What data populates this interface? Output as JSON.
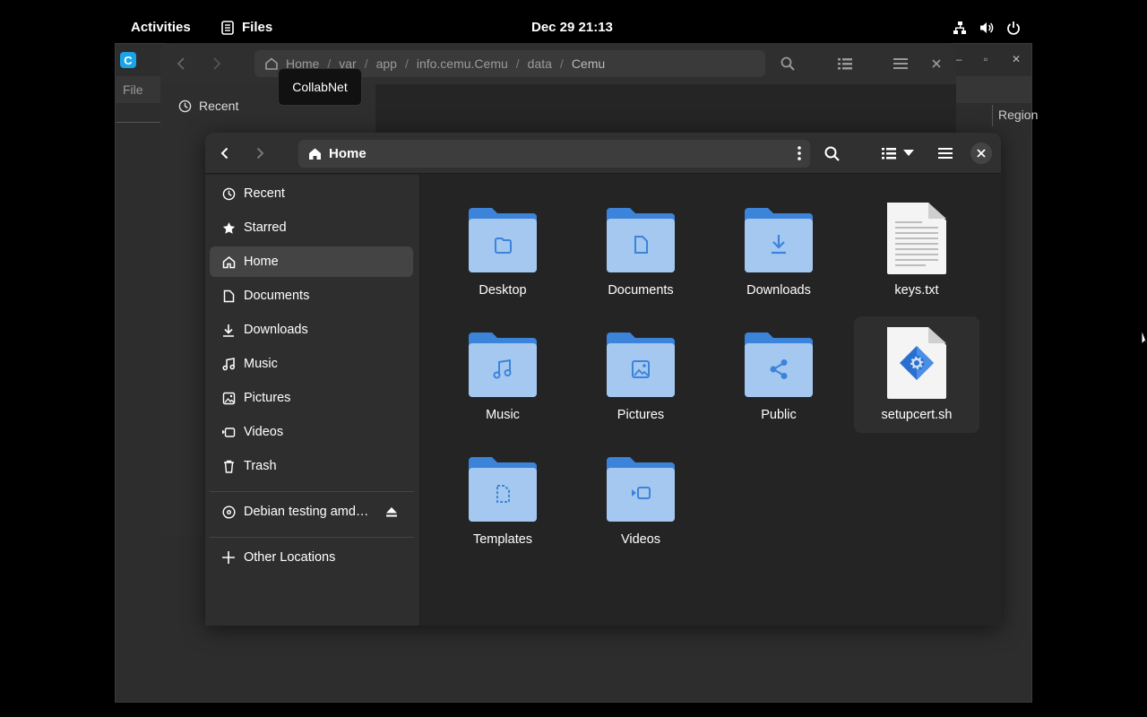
{
  "topbar": {
    "activities": "Activities",
    "app_name": "Files",
    "clock": "Dec 29  21:13",
    "tray_icons": [
      "network-icon",
      "volume-icon",
      "power-icon"
    ]
  },
  "cemu_window": {
    "logo_letter": "C",
    "menu_file": "File",
    "column_region": "Region"
  },
  "back_files_window": {
    "path": [
      "Home",
      "var",
      "app",
      "info.cemu.Cemu",
      "data",
      "Cemu"
    ],
    "sidebar_first": "Recent"
  },
  "tooltip": {
    "text": "CollabNet"
  },
  "files_window": {
    "location": "Home",
    "sidebar": {
      "items": [
        {
          "label": "Recent",
          "icon": "clock-icon"
        },
        {
          "label": "Starred",
          "icon": "star-icon"
        },
        {
          "label": "Home",
          "icon": "home-icon",
          "active": true
        },
        {
          "label": "Documents",
          "icon": "document-icon"
        },
        {
          "label": "Downloads",
          "icon": "download-icon"
        },
        {
          "label": "Music",
          "icon": "music-icon"
        },
        {
          "label": "Pictures",
          "icon": "picture-icon"
        },
        {
          "label": "Videos",
          "icon": "video-icon"
        },
        {
          "label": "Trash",
          "icon": "trash-icon"
        }
      ],
      "drive": "Debian testing amd…",
      "other_locations": "Other Locations"
    },
    "files": [
      {
        "name": "Desktop",
        "type": "folder",
        "emblem": "desktop"
      },
      {
        "name": "Documents",
        "type": "folder",
        "emblem": "document"
      },
      {
        "name": "Downloads",
        "type": "folder",
        "emblem": "download"
      },
      {
        "name": "keys.txt",
        "type": "text-file"
      },
      {
        "name": "Music",
        "type": "folder",
        "emblem": "music"
      },
      {
        "name": "Pictures",
        "type": "folder",
        "emblem": "picture"
      },
      {
        "name": "Public",
        "type": "folder",
        "emblem": "share"
      },
      {
        "name": "setupcert.sh",
        "type": "script-file"
      },
      {
        "name": "Templates",
        "type": "folder",
        "emblem": "template"
      },
      {
        "name": "Videos",
        "type": "folder",
        "emblem": "video"
      }
    ]
  },
  "colors": {
    "folder_back": "#3c83da",
    "folder_front": "#a4c8f0",
    "folder_emblem": "#3c83da",
    "accent": "#1aa3e8"
  }
}
